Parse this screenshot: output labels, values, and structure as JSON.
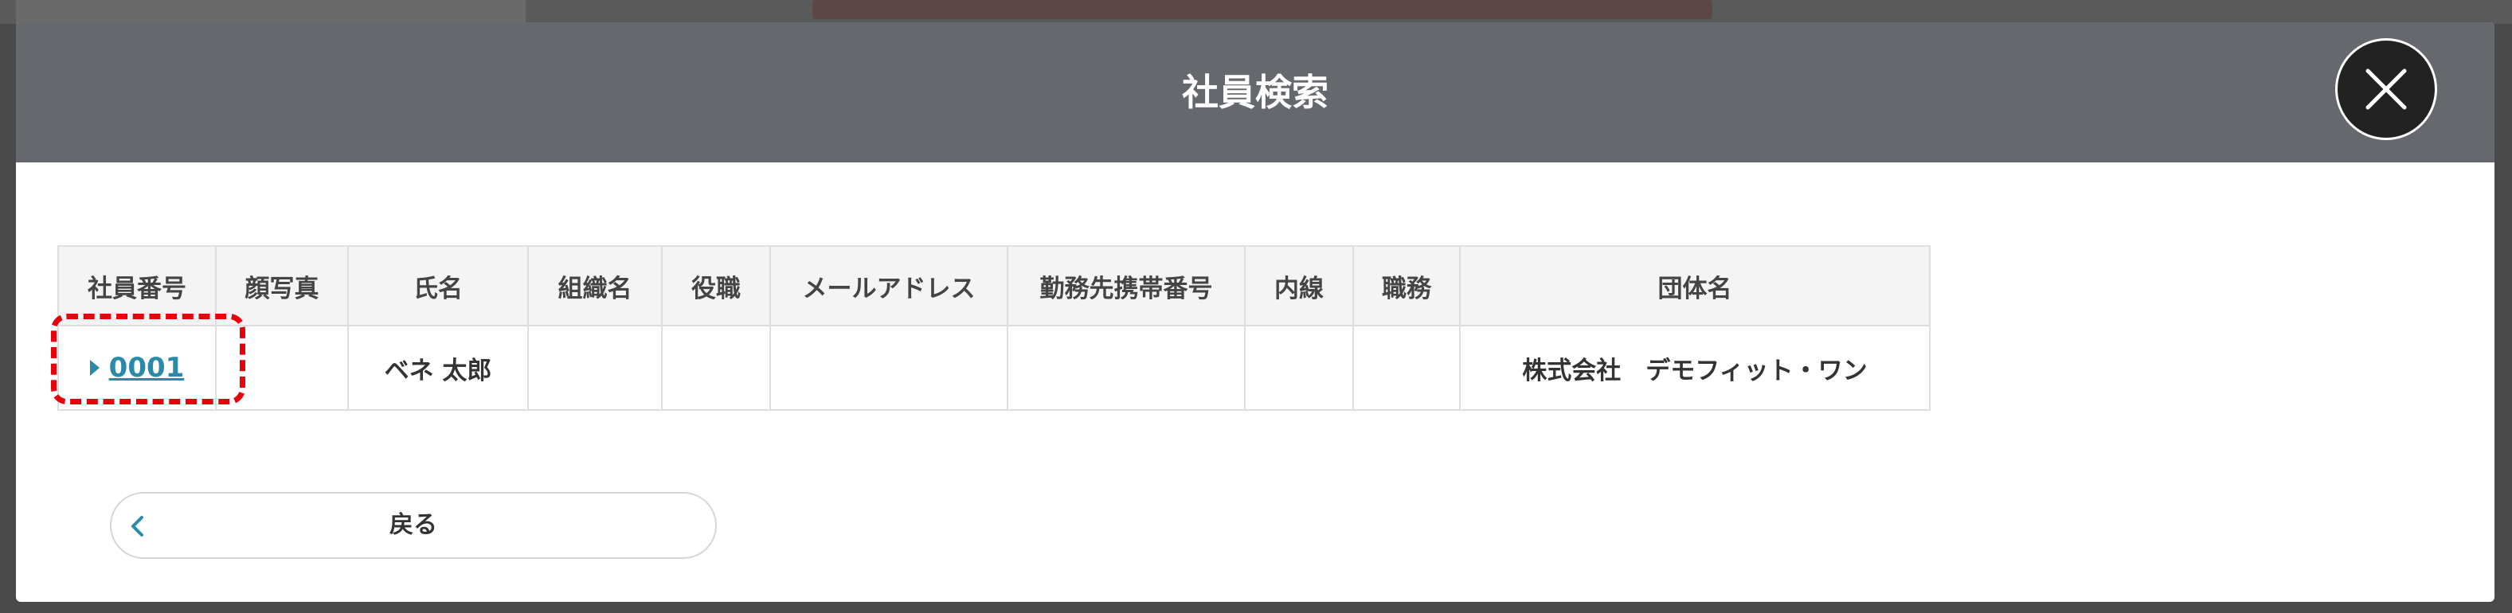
{
  "modal": {
    "title": "社員検索",
    "close_icon": "close-icon"
  },
  "table": {
    "headers": [
      "社員番号",
      "顔写真",
      "氏名",
      "組織名",
      "役職",
      "メールアドレス",
      "勤務先携帯番号",
      "内線",
      "職務",
      "団体名"
    ],
    "rows": [
      {
        "employee_no": "0001",
        "photo": "",
        "name": "ベネ 太郎",
        "organization": "",
        "position": "",
        "email": "",
        "work_mobile": "",
        "extension": "",
        "duty": "",
        "group_name": "株式会社　デモフィット・ワン"
      }
    ]
  },
  "back_button": {
    "label": "戻る",
    "icon": "chevron-left-icon"
  },
  "colors": {
    "header_bg": "#65686c",
    "link": "#2b8aa8",
    "highlight": "#e8000b",
    "close_bg": "#222222"
  }
}
